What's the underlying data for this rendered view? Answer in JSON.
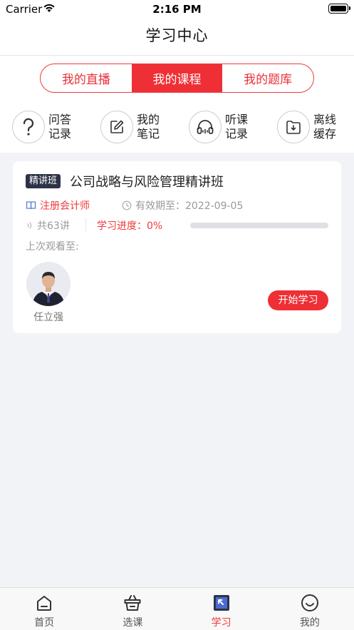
{
  "status_bar": {
    "carrier": "Carrier",
    "time": "2:16 PM"
  },
  "header": {
    "title": "学习中心"
  },
  "segments": [
    {
      "label": "我的直播",
      "active": false
    },
    {
      "label": "我的课程",
      "active": true
    },
    {
      "label": "我的题库",
      "active": false
    }
  ],
  "quick_actions": [
    {
      "line1": "问答",
      "line2": "记录",
      "icon": "question-icon"
    },
    {
      "line1": "我的",
      "line2": "笔记",
      "icon": "edit-icon"
    },
    {
      "line1": "听课",
      "line2": "记录",
      "icon": "headphones-icon"
    },
    {
      "line1": "离线",
      "line2": "缓存",
      "icon": "download-folder-icon"
    }
  ],
  "course": {
    "tag": "精讲班",
    "title": "公司战略与风险管理精讲班",
    "subject": "注册会计师",
    "valid_until": "有效期至：2022-09-05",
    "lessons": "共63讲",
    "progress_text": "学习进度：0%",
    "progress_value": 0,
    "last_watched": "上次观看至:",
    "teacher": "任立强",
    "start_label": "开始学习"
  },
  "tabbar": [
    {
      "label": "首页",
      "icon": "home-icon",
      "active": false
    },
    {
      "label": "选课",
      "icon": "basket-icon",
      "active": false
    },
    {
      "label": "学习",
      "icon": "study-icon",
      "active": true
    },
    {
      "label": "我的",
      "icon": "smile-icon",
      "active": false
    }
  ],
  "colors": {
    "accent": "#ef2f36",
    "tag_bg": "#2d3347",
    "page_bg": "#f2f3f7"
  }
}
